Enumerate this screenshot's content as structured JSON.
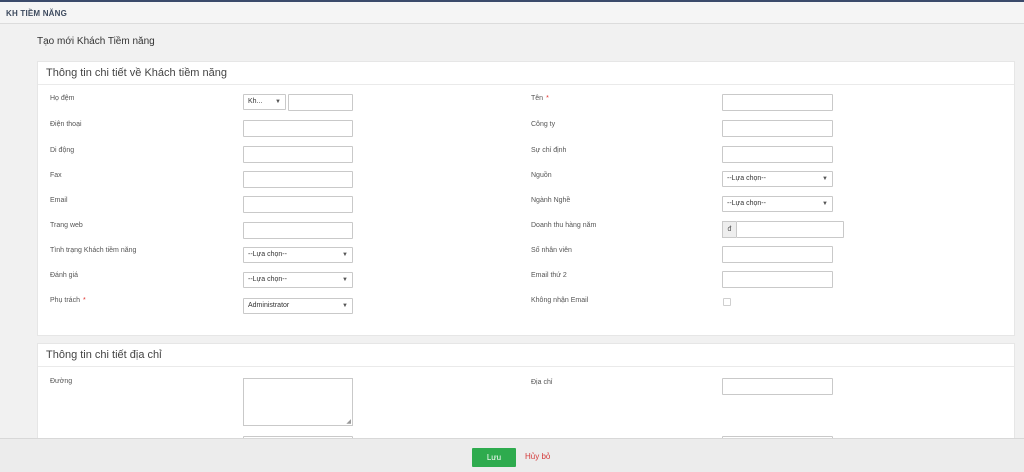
{
  "header": {
    "title": "KH TIỀM NĂNG"
  },
  "page": {
    "title": "Tạo mới Khách Tiềm năng"
  },
  "section1": {
    "title": "Thông tin chi tiết về Khách tiềm năng",
    "left": {
      "ho_dem_label": "Họ đệm",
      "salutation_value": "Kh...",
      "dien_thoai_label": "Điện thoại",
      "di_dong_label": "Di động",
      "fax_label": "Fax",
      "email_label": "Email",
      "trang_web_label": "Trang web",
      "tinh_trang_label": "Tình trạng Khách tiềm năng",
      "tinh_trang_value": "--Lựa chọn--",
      "danh_gia_label": "Đánh giá",
      "danh_gia_value": "--Lựa chọn--",
      "phu_trach_label": "Phụ trách",
      "phu_trach_value": "Administrator"
    },
    "right": {
      "ten_label": "Tên",
      "cong_ty_label": "Công ty",
      "su_chi_dinh_label": "Sự chỉ định",
      "nguon_label": "Nguồn",
      "nguon_value": "--Lựa chọn--",
      "nganh_nghe_label": "Ngành Nghề",
      "nganh_nghe_value": "--Lựa chọn--",
      "doanh_thu_label": "Doanh thu hàng năm",
      "currency_symbol": "đ",
      "so_nhan_vien_label": "Số nhân viên",
      "email_thu_2_label": "Email thứ 2",
      "khong_nhan_email_label": "Không nhận Email"
    },
    "required_mark": "*"
  },
  "section2": {
    "title": "Thông tin chi tiết địa chỉ",
    "duong_label": "Đường",
    "dia_chi_label": "Địa chỉ"
  },
  "footer": {
    "save_label": "Lưu",
    "cancel_label": "Hủy bỏ"
  },
  "colors": {
    "accent_green": "#2eab4e",
    "cancel_red": "#d43a3a",
    "header_line": "#3b4a6b"
  }
}
